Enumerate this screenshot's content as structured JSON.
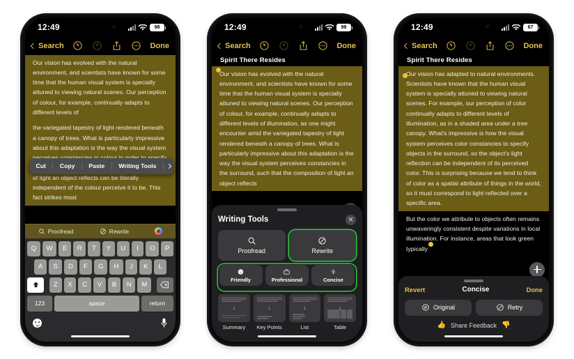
{
  "background_color": "#ffffff",
  "accent_color": "#e3c055",
  "highlight_color": "#6b5c16",
  "green_highlight": "#2fbf34",
  "phones": [
    {
      "id": "phone-selection-menu",
      "status": {
        "time": "12:49",
        "battery": "98",
        "signal_icon": "cellular-bars-icon",
        "wifi_icon": "wifi-icon",
        "battery_icon": "battery-icon"
      },
      "toolbar": {
        "back_label": "Search",
        "undo_icon": "undo-icon",
        "redo_icon": "redo-icon",
        "share_icon": "share-icon",
        "more_icon": "more-ellipsis-icon",
        "done_label": "Done"
      },
      "note": {
        "title": "",
        "paragraph_top": "Our vision has evolved with the natural environment, and scientists have known for some time that the human visual system is specially attuned to viewing natural scenes. Our perception of colour, for example, continually adapts to different levels of",
        "paragraph_bottom": "the variegated tapestry of light rendered beneath a canopy of trees. What is particularly impressive about this adaptation is the way the visual system perceives constancies in colour in order to specify objects in the surround, such that the composition of light an object reflects can be literally independent of the colour perceive it to be. This fact strikes most"
      },
      "context_menu": {
        "items": [
          "Cut",
          "Copy",
          "Paste",
          "Writing Tools"
        ],
        "more_icon": "chevron-right-icon"
      },
      "suggestion_bar": {
        "proofread_label": "Proofread",
        "proofread_icon": "magnifier-proofread-icon",
        "rewrite_label": "Rewrite",
        "rewrite_icon": "rewrite-wand-icon",
        "ai_icon": "apple-intelligence-icon"
      },
      "keyboard": {
        "row1": [
          "Q",
          "W",
          "E",
          "R",
          "T",
          "Y",
          "U",
          "I",
          "O",
          "P"
        ],
        "row2": [
          "A",
          "S",
          "D",
          "F",
          "G",
          "H",
          "J",
          "K",
          "L"
        ],
        "row3": [
          "Z",
          "X",
          "C",
          "V",
          "B",
          "N",
          "M"
        ],
        "shift_icon": "shift-icon",
        "backspace_icon": "backspace-icon",
        "numbers_label": "123",
        "space_label": "space",
        "return_label": "return",
        "emoji_icon": "emoji-icon",
        "mic_icon": "microphone-icon"
      },
      "add_button_icon": "plus-icon"
    },
    {
      "id": "phone-writing-tools",
      "status": {
        "time": "12:49",
        "battery": "98",
        "signal_icon": "cellular-bars-icon",
        "wifi_icon": "wifi-icon",
        "battery_icon": "battery-icon"
      },
      "toolbar": {
        "back_label": "Search",
        "undo_icon": "undo-icon",
        "redo_icon": "redo-icon",
        "share_icon": "share-icon",
        "more_icon": "more-ellipsis-icon",
        "done_label": "Done"
      },
      "note": {
        "title": "Spirit There Resides",
        "paragraph_top": "Our vision has evolved with the natural environment, and scientists have known for some time that the human visual system is specially attuned to viewing natural scenes. Our perception of colour, for example, continually adapts to different levels of illumination, as one might encounter amid the variegated tapestry of light rendered beneath a canopy of trees. What is particularly impressive about this adaptation is the way the visual system perceives constancies in the surround, such that the composition of light an object reflects"
      },
      "writing_tools": {
        "title": "Writing Tools",
        "close_icon": "close-icon",
        "primary": [
          {
            "label": "Proofread",
            "icon": "magnifier-proofread-icon",
            "highlighted": false
          },
          {
            "label": "Rewrite",
            "icon": "rewrite-wand-icon",
            "highlighted": true
          }
        ],
        "tones": [
          {
            "label": "Friendly",
            "icon": "smiley-icon"
          },
          {
            "label": "Professional",
            "icon": "briefcase-icon"
          },
          {
            "label": "Concise",
            "icon": "divide-icon"
          }
        ],
        "documents": [
          {
            "label": "Summary",
            "icon": "summary-doc-icon"
          },
          {
            "label": "Key Points",
            "icon": "key-points-doc-icon"
          },
          {
            "label": "List",
            "icon": "list-doc-icon"
          },
          {
            "label": "Table",
            "icon": "table-doc-icon"
          }
        ]
      },
      "add_button_icon": "plus-icon"
    },
    {
      "id": "phone-concise-result",
      "status": {
        "time": "12:49",
        "battery": "67",
        "signal_icon": "cellular-bars-icon",
        "wifi_icon": "wifi-icon",
        "battery_icon": "battery-icon"
      },
      "toolbar": {
        "back_label": "Search",
        "undo_icon": "undo-icon",
        "redo_icon": "redo-icon",
        "share_icon": "share-icon",
        "more_icon": "more-ellipsis-icon",
        "done_label": "Done"
      },
      "note": {
        "title": "Spirit There Resides",
        "paragraph_top": "Our vision has adapted to natural environments. Scientists have known that the human visual system is specially attuned to viewing natural scenes. For example, our perception of color continually adapts to different levels of illumination, as in a shaded area under a tree canopy. What's impressive is how the visual system perceives color constancies to specify objects in the surround, so the object's light reflection can be independent of its perceived color. This is surprising because we tend to think of color as a spatial attribute of things in the world, so it must correspond to light reflected over a specific area.",
        "paragraph_bottom": "But the color we attribute to objects often remains unwaveringly consistent despite variations in local illumination. For instance, areas that look green typically"
      },
      "result_sheet": {
        "revert_label": "Revert",
        "title": "Concise",
        "done_label": "Done",
        "buttons": [
          {
            "label": "Original",
            "icon": "original-icon"
          },
          {
            "label": "Retry",
            "icon": "retry-icon"
          }
        ],
        "feedback_label": "Share Feedback",
        "thumbs_up_icon": "thumbs-up-icon",
        "thumbs_down_icon": "thumbs-down-icon"
      },
      "add_button_icon": "plus-icon"
    }
  ]
}
